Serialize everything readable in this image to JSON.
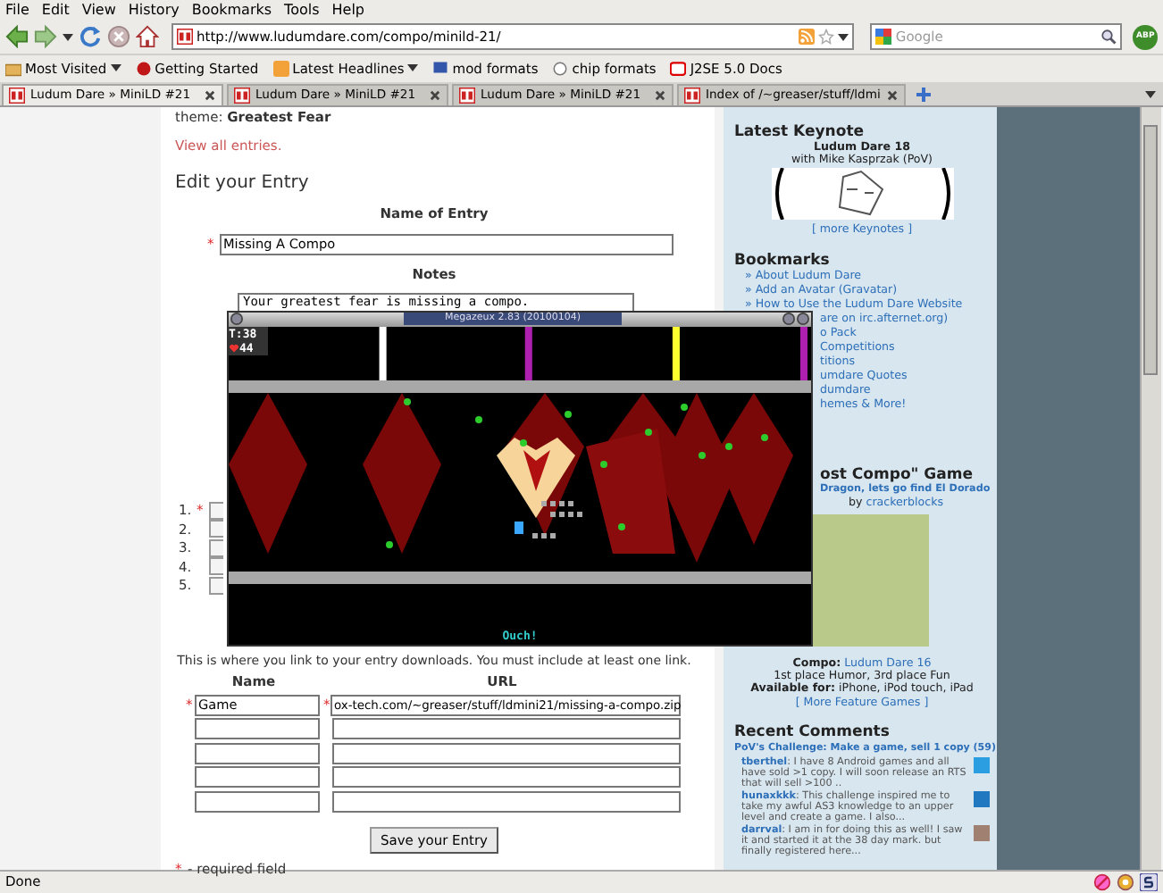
{
  "menu": [
    "File",
    "Edit",
    "View",
    "History",
    "Bookmarks",
    "Tools",
    "Help"
  ],
  "toolbar": {
    "url": "http://www.ludumdare.com/compo/minild-21/",
    "search_placeholder": "Google",
    "addon_badge": "ABP"
  },
  "bookmarks_bar": [
    {
      "label": "Most Visited",
      "menu": true
    },
    {
      "label": "Getting Started",
      "menu": false
    },
    {
      "label": "Latest Headlines",
      "menu": true
    },
    {
      "label": "mod formats",
      "menu": false
    },
    {
      "label": "chip formats",
      "menu": false
    },
    {
      "label": "J2SE 5.0 Docs",
      "menu": false
    }
  ],
  "tabs": [
    {
      "label": "Ludum Dare » MiniLD #21",
      "selected": true
    },
    {
      "label": "Ludum Dare » MiniLD #21",
      "selected": false
    },
    {
      "label": "Ludum Dare » MiniLD #21",
      "selected": false
    },
    {
      "label": "Index of /~greaser/stuff/ldmi",
      "selected": false
    }
  ],
  "main": {
    "theme": "theme: **Greatest Fear**",
    "view_all_link": "View all entries.",
    "heading": "Edit your Entry",
    "name_label": "Name of Entry",
    "name_field": {
      "mark": "*",
      "value": "Missing A Compo"
    },
    "notes_label": "Notes",
    "notes_value": "Your greatest fear is missing a compo.",
    "link_rows": [
      {
        "number": "1.",
        "mark": "*"
      },
      {
        "number": "2."
      },
      {
        "number": "3."
      },
      {
        "number": "4."
      },
      {
        "number": "5."
      }
    ],
    "downloads_hint": "This is where you link to your entry downloads. You must include at least one link.",
    "columns": [
      "Name",
      "URL"
    ],
    "download_rows": [
      {
        "name_mark": "*",
        "name": "Game",
        "url_mark": "*",
        "url": "ox-tech.com/~greaser/stuff/ldmini21/missing-a-compo.zip"
      },
      {},
      {},
      {},
      {}
    ],
    "save_button": "Save your Entry",
    "required_note": {
      "mark": "*",
      "text": "- required field"
    }
  },
  "game_window": {
    "title": "Megazeux 2.83 (20100104)",
    "time": "T:38",
    "health": "44",
    "message": "Ouch!"
  },
  "sidebar": {
    "keynote": {
      "heading": "Latest Keynote",
      "title": "Ludum Dare 18",
      "subtitle": "with Mike Kasprzak (PoV)",
      "more_link": "[ more Keynotes ]"
    },
    "bookmarks": {
      "heading": "Bookmarks",
      "items": [
        {
          "label": "» About Ludum Dare",
          "kind": "full"
        },
        {
          "label": "» Add an Avatar (Gravatar)",
          "kind": "full"
        },
        {
          "label": "» How to Use the Ludum Dare Website",
          "kind": "full"
        },
        {
          "label": "are on irc.afternet.org)",
          "kind": "partial"
        },
        {
          "label": "o Pack",
          "kind": "partial"
        },
        {
          "label": "Competitions",
          "kind": "partial"
        },
        {
          "label": "titions",
          "kind": "partial"
        },
        {
          "label": "umdare Quotes",
          "kind": "partial"
        },
        {
          "label": "dumdare",
          "kind": "partial"
        },
        {
          "label": "hemes & More!",
          "kind": "partial"
        }
      ]
    },
    "featured": {
      "heading": "ost Compo\" Game",
      "title": "Dragon, lets go find El Dorado",
      "by": "by",
      "author": "crackerblocks",
      "compo_label": "Compo:",
      "compo_link": "Ludum Dare 16",
      "places": "1st place Humor, 3rd place Fun",
      "available_label": "Available for:",
      "platforms": "iPhone, iPod touch, iPad",
      "more_link": "[ More Feature Games ]"
    },
    "comments": {
      "heading": "Recent Comments",
      "post": "PoV's Challenge: Make a game, sell 1 copy (59)",
      "items": [
        {
          "author": "tberthel",
          "text": ": I have 8 Android games and all have sold >1 copy. I will soon release an RTS that will sell >100 ..",
          "color": "#2a9ee0"
        },
        {
          "author": "hunaxkkk",
          "text": ": This challenge inspired me to take my awful AS3 knowledge to an upper level and create a game. I also...",
          "color": "#1f78c0"
        },
        {
          "author": "darrval",
          "text": ": I am in for doing this as well! I saw it and started it at the 38 day mark. but finally registered here...",
          "color": "#a08070"
        }
      ]
    }
  },
  "status_bar": {
    "text": "Done"
  }
}
